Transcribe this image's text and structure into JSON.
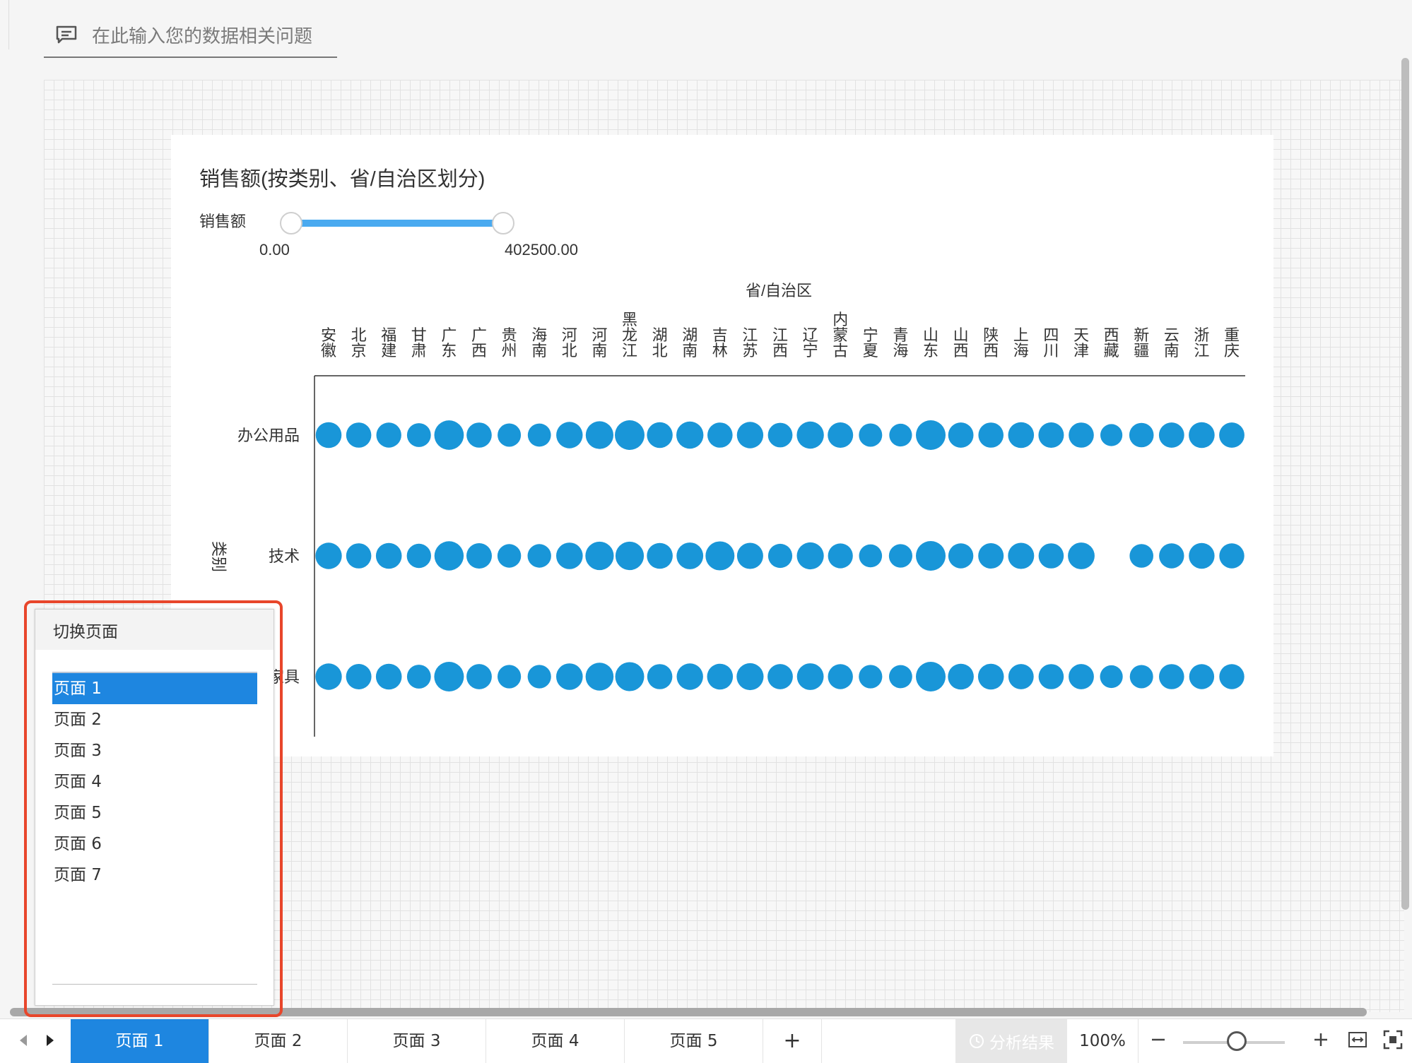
{
  "query": {
    "placeholder": "在此输入您的数据相关问题"
  },
  "chart": {
    "title": "销售额(按类别、省/自治区划分)",
    "slider": {
      "label": "销售额",
      "min": "0.00",
      "max": "402500.00"
    }
  },
  "chart_data": {
    "type": "scatter",
    "title": "销售额(按类别、省/自治区划分)",
    "xlabel": "省/自治区",
    "ylabel": "类别",
    "x_categories": [
      "安徽",
      "北京",
      "福建",
      "甘肃",
      "广东",
      "广西",
      "贵州",
      "海南",
      "河北",
      "河南",
      "黑龙江",
      "湖北",
      "湖南",
      "吉林",
      "江苏",
      "江西",
      "辽宁",
      "内蒙古",
      "宁夏",
      "青海",
      "山东",
      "山西",
      "陕西",
      "上海",
      "四川",
      "天津",
      "西藏",
      "新疆",
      "云南",
      "浙江",
      "重庆"
    ],
    "y_categories": [
      "办公用品",
      "技术",
      "家具"
    ],
    "size_measure": "销售额",
    "size_range": [
      0,
      402500
    ],
    "grid": false,
    "legend": "none",
    "series": [
      {
        "name": "办公用品",
        "values": [
          200000,
          170000,
          160000,
          120000,
          390000,
          170000,
          100000,
          95000,
          220000,
          290000,
          400000,
          190000,
          260000,
          170000,
          220000,
          145000,
          260000,
          180000,
          100000,
          85000,
          402500,
          175000,
          170000,
          200000,
          180000,
          165000,
          65000,
          140000,
          175000,
          200000,
          175000
        ]
      },
      {
        "name": "技术",
        "values": [
          220000,
          170000,
          195000,
          135000,
          380000,
          180000,
          110000,
          110000,
          230000,
          330000,
          330000,
          200000,
          240000,
          360000,
          210000,
          130000,
          250000,
          155000,
          90000,
          105000,
          400000,
          160000,
          180000,
          210000,
          170000,
          235000,
          null,
          115000,
          160000,
          190000,
          160000
        ]
      },
      {
        "name": "家具",
        "values": [
          225000,
          180000,
          200000,
          120000,
          400000,
          175000,
          105000,
          105000,
          230000,
          300000,
          360000,
          170000,
          225000,
          200000,
          250000,
          175000,
          235000,
          160000,
          105000,
          95000,
          400000,
          200000,
          195000,
          175000,
          170000,
          175000,
          85000,
          100000,
          170000,
          160000,
          160000
        ]
      }
    ]
  },
  "page_switch": {
    "title": "切换页面",
    "items": [
      "页面 1",
      "页面 2",
      "页面 3",
      "页面 4",
      "页面 5",
      "页面 6",
      "页面 7"
    ],
    "selected_index": 0
  },
  "bottom": {
    "tabs": [
      "页面 1",
      "页面 2",
      "页面 3",
      "页面 4",
      "页面 5"
    ],
    "active_index": 0,
    "add_label": "+",
    "analysis_label": "分析结果",
    "zoom": "100%",
    "zoom_value": 0.5
  },
  "colors": {
    "accent": "#1e86e0",
    "bubble": "#1996d8",
    "highlight": "#e8462b"
  },
  "icons": [
    "comment-icon",
    "chevron-left-icon",
    "chevron-right-icon",
    "analysis-icon",
    "zoom-out-icon",
    "zoom-in-icon",
    "fit-width-icon",
    "fit-screen-icon"
  ]
}
